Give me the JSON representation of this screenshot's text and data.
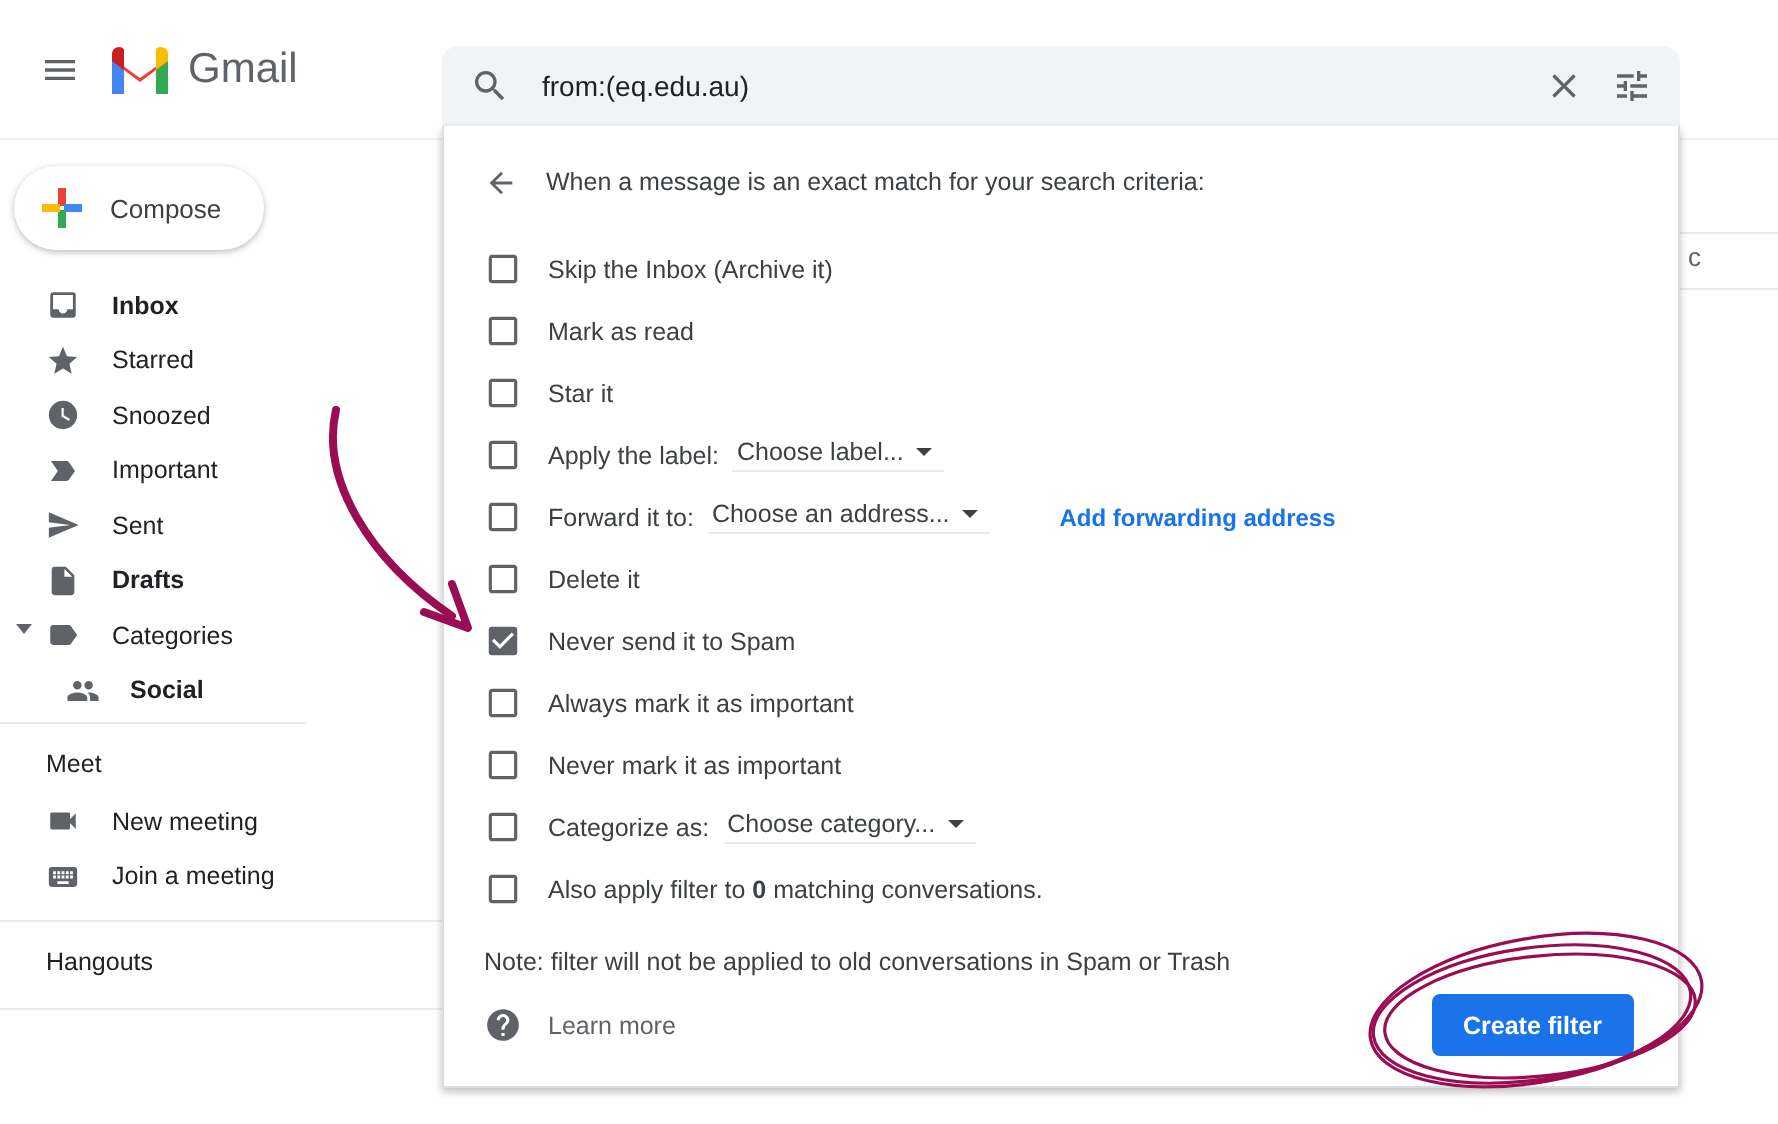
{
  "header": {
    "app_name": "Gmail"
  },
  "search": {
    "value": "from:(eq.edu.au)"
  },
  "compose": {
    "label": "Compose"
  },
  "nav": [
    {
      "label": "Inbox",
      "kind": "inbox",
      "unread": true
    },
    {
      "label": "Starred",
      "kind": "star",
      "unread": false
    },
    {
      "label": "Snoozed",
      "kind": "clock",
      "unread": false
    },
    {
      "label": "Important",
      "kind": "important",
      "unread": false
    },
    {
      "label": "Sent",
      "kind": "send",
      "unread": false
    },
    {
      "label": "Drafts",
      "kind": "file",
      "unread": true
    },
    {
      "label": "Categories",
      "kind": "label",
      "unread": false,
      "expanded": true,
      "children": [
        {
          "label": "Social",
          "kind": "people",
          "unread": true
        }
      ]
    }
  ],
  "meet": {
    "title": "Meet",
    "items": [
      {
        "label": "New meeting",
        "kind": "video"
      },
      {
        "label": "Join a meeting",
        "kind": "keyboard"
      }
    ]
  },
  "hangouts": {
    "title": "Hangouts"
  },
  "mail_fragment": "c",
  "filter": {
    "heading": "When a message is an exact match for your search criteria:",
    "options": [
      {
        "label": "Skip the Inbox (Archive it)",
        "checked": false
      },
      {
        "label": "Mark as read",
        "checked": false
      },
      {
        "label": "Star it",
        "checked": false
      },
      {
        "label": "Apply the label:",
        "checked": false,
        "dropdown": "Choose label..."
      },
      {
        "label": "Forward it to:",
        "checked": false,
        "dropdown": "Choose an address...",
        "link": "Add forwarding address"
      },
      {
        "label": "Delete it",
        "checked": false
      },
      {
        "label": "Never send it to Spam",
        "checked": true
      },
      {
        "label": "Always mark it as important",
        "checked": false
      },
      {
        "label": "Never mark it as important",
        "checked": false
      },
      {
        "label": "Categorize as:",
        "checked": false,
        "dropdown": "Choose category..."
      },
      {
        "label": "Also apply filter to **0** matching conversations.",
        "checked": false
      }
    ],
    "note": "Note: filter will not be applied to old conversations in Spam or Trash",
    "learn_more": "Learn more",
    "create_button": "Create filter"
  }
}
